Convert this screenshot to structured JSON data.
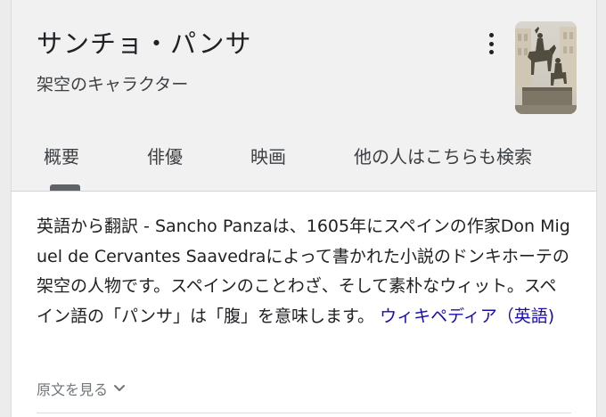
{
  "header": {
    "title": "サンチョ・パンサ",
    "subtitle": "架空のキャラクター",
    "more_icon": "more-vert-icon",
    "thumbnail": "don-quixote-statue-image"
  },
  "tabs": [
    {
      "label": "概要",
      "selected": true
    },
    {
      "label": "俳優",
      "selected": false
    },
    {
      "label": "映画",
      "selected": false
    },
    {
      "label": "他の人はこちらも検索",
      "selected": false
    }
  ],
  "description": {
    "prefix": "英語から翻訳 - ",
    "name": "Sancho Panza",
    "text1": "は、1605年にスペインの作家",
    "author": "Don Miguel de Cervantes Saavedra",
    "text2": "によって書かれた小説のドンキホーテの架空の人物です。スペインのことわざ、そして素朴なウィット。スペイン語の「パンサ」は「腹」を意味します。",
    "source_link": "ウィキペディア（英語)"
  },
  "show_original": {
    "label": "原文を見る",
    "icon": "chevron-down-icon"
  },
  "colors": {
    "link": "#1a0dab",
    "header_bg": "#f1f1f1",
    "tab_indicator": "#5f6368"
  }
}
